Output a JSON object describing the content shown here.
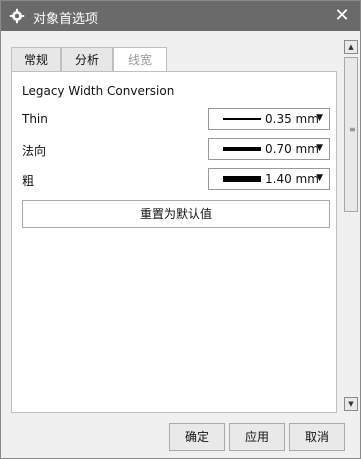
{
  "window": {
    "title": "对象首选项",
    "close_symbol": "✕"
  },
  "tabs": [
    {
      "label": "常规"
    },
    {
      "label": "分析"
    },
    {
      "label": "线宽"
    }
  ],
  "panel": {
    "section_title": "Legacy Width Conversion",
    "rows": [
      {
        "label": "Thin",
        "value": "0.35 mm"
      },
      {
        "label": "法向",
        "value": "0.70 mm"
      },
      {
        "label": "粗",
        "value": "1.40 mm"
      }
    ],
    "reset_label": "重置为默认值"
  },
  "footer": {
    "ok_label": "确定",
    "apply_label": "应用",
    "cancel_label": "取消"
  },
  "icons": {
    "title_icon": "gear-icon",
    "dropdown_arrow": "chevron-down-icon",
    "scroll_up": "scroll-up-arrow-icon",
    "scroll_down": "scroll-down-arrow-icon"
  }
}
